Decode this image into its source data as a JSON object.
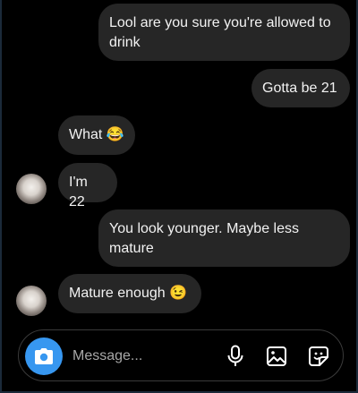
{
  "messages": [
    {
      "side": "outgoing",
      "text": "Lool are you sure you're allowed to drink"
    },
    {
      "side": "outgoing",
      "text": "Gotta be 21"
    },
    {
      "side": "incoming",
      "text": "What 😂"
    },
    {
      "side": "incoming",
      "text": "I'm 22"
    },
    {
      "side": "outgoing",
      "text": "You look younger. Maybe less mature"
    },
    {
      "side": "incoming",
      "text": "Mature enough 😉"
    }
  ],
  "composer": {
    "placeholder": "Message...",
    "value": "",
    "icons": [
      "camera-icon",
      "microphone-icon",
      "gallery-icon",
      "sticker-icon"
    ]
  },
  "colors": {
    "background": "#000000",
    "bubble": "#262626",
    "accent": "#3797f0"
  }
}
